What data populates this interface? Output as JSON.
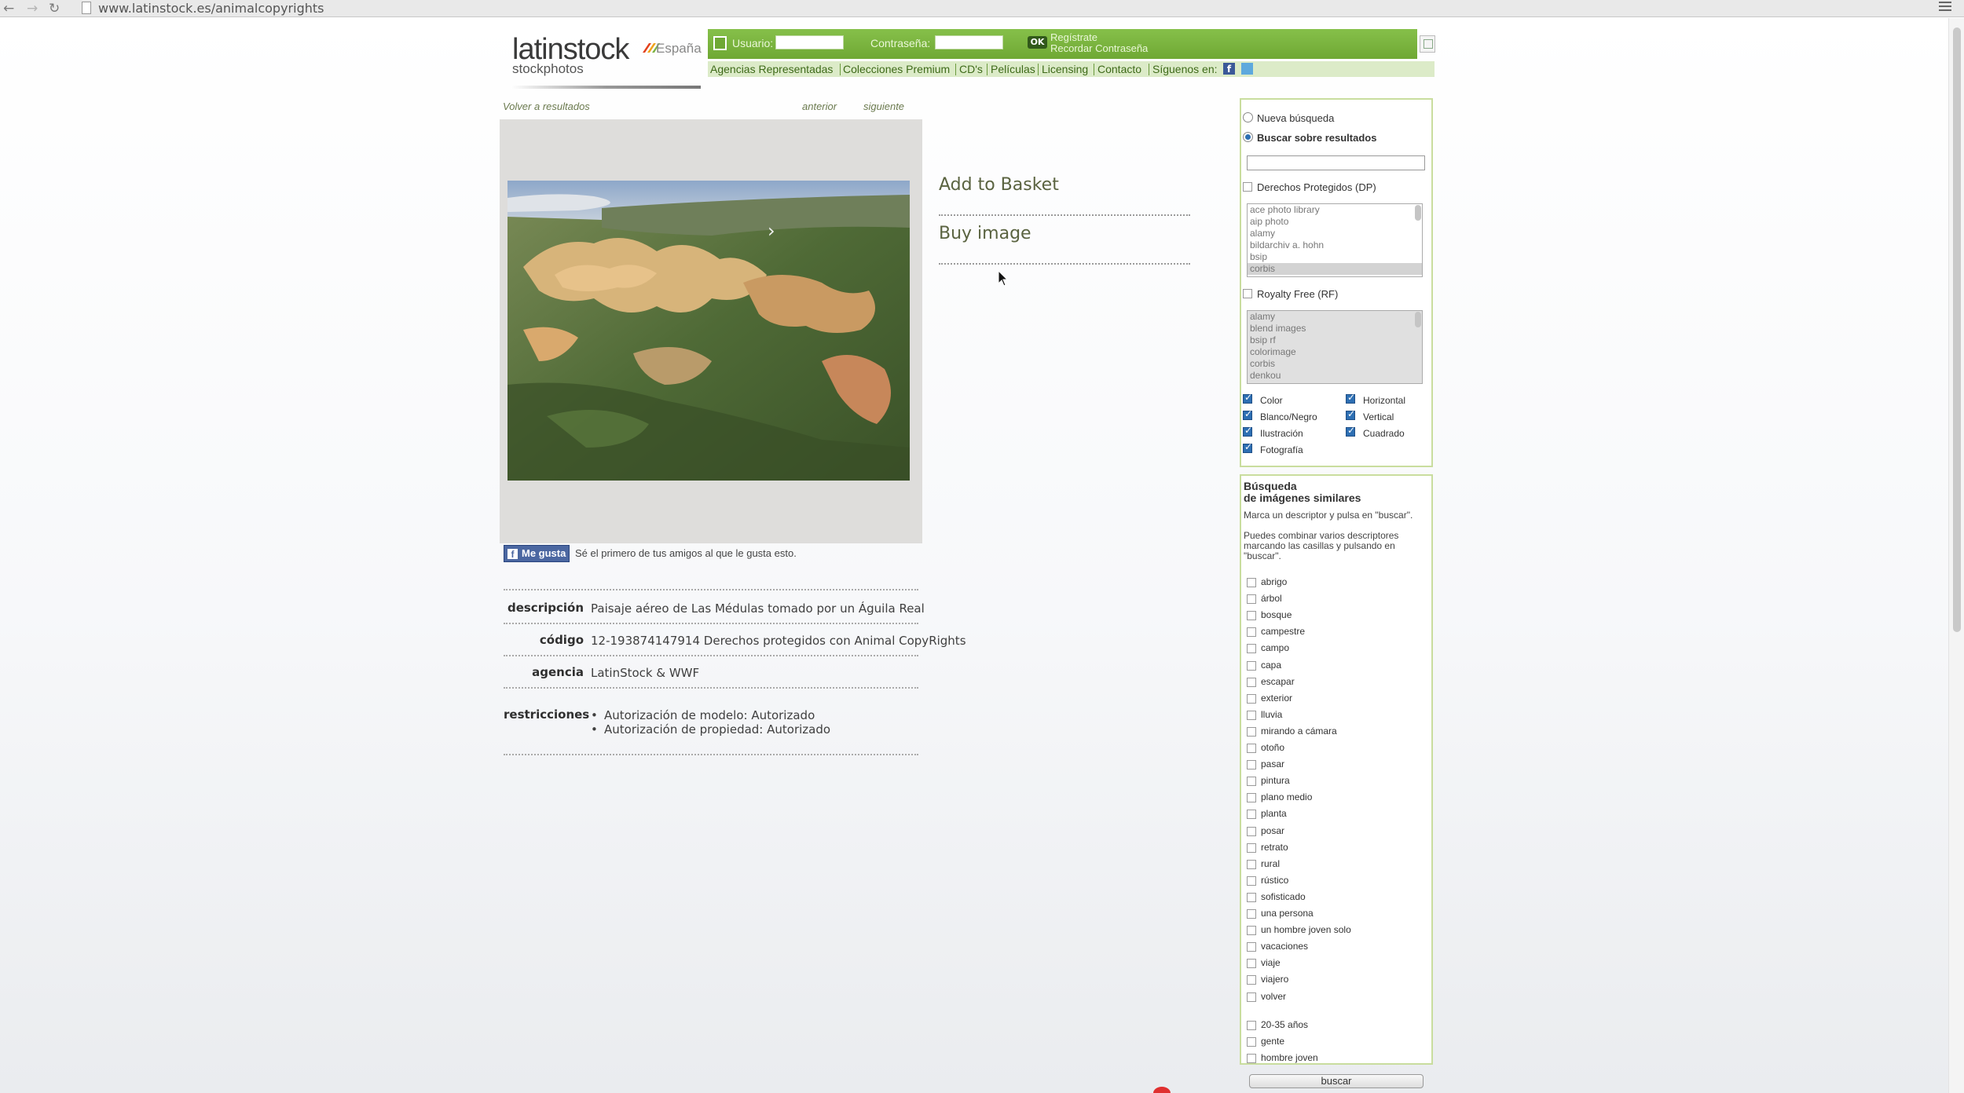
{
  "browser": {
    "url": "www.latinstock.es/animalcopyrights",
    "back_icon": "←",
    "forward_icon": "→",
    "reload_icon": "↻"
  },
  "header": {
    "logo_main": "latinstock",
    "logo_sub": "stockphotos",
    "country": "España",
    "user_label": "Usuario:",
    "password_label": "Contraseña:",
    "ok_label": "OK",
    "register_link": "Regístrate",
    "recover_link": "Recordar Contraseña",
    "nav": [
      "Agencias Representadas",
      "Colecciones Premium",
      "CD's",
      "Películas",
      "Licensing",
      "Contacto",
      "Síguenos en:"
    ],
    "accent_color": "#7cb342"
  },
  "detail": {
    "back_link": "Volver a resultados",
    "prev_link": "anterior",
    "next_link": "siguiente",
    "add_basket": "Add to Basket",
    "buy_image": "Buy image",
    "fb_like": "Me gusta",
    "fb_text": "Sé el primero de tus amigos al que le gusta esto.",
    "labels": {
      "descripcion": "descripción",
      "codigo": "código",
      "agencia": "agencia",
      "restricciones": "restricciones"
    },
    "values": {
      "descripcion": "Paisaje aéreo de Las Médulas tomado por un Águila Real",
      "codigo": "12-193874147914 Derechos protegidos con Animal CopyRights",
      "agencia": "LatinStock & WWF"
    },
    "restricciones": [
      "Autorización de modelo: Autorizado",
      "Autorización de propiedad: Autorizado"
    ]
  },
  "sidebar": {
    "new_search": "Nueva búsqueda",
    "search_results": "Buscar sobre resultados",
    "dp_label": "Derechos Protegidos (DP)",
    "dp_list": [
      "ace photo library",
      "aip photo",
      "alamy",
      "bildarchiv a. hohn",
      "bsip",
      "corbis"
    ],
    "rf_label": "Royalty Free (RF)",
    "rf_list": [
      "alamy",
      "blend images",
      "bsip rf",
      "colorimage",
      "corbis",
      "denkou"
    ],
    "filters_left": [
      "Color",
      "Blanco/Negro",
      "Ilustración",
      "Fotografía"
    ],
    "filters_right": [
      "Horizontal",
      "Vertical",
      "Cuadrado"
    ],
    "similar_title_1": "Búsqueda",
    "similar_title_2": "de imágenes similares",
    "similar_hint_1": "Marca un descriptor y pulsa en \"buscar\".",
    "similar_hint_2": "Puedes combinar varios descriptores marcando las casillas y pulsando en \"buscar\".",
    "descriptors": [
      "abrigo",
      "árbol",
      "bosque",
      "campestre",
      "campo",
      "capa",
      "escapar",
      "exterior",
      "lluvia",
      "mirando a cámara",
      "otoño",
      "pasar",
      "pintura",
      "plano medio",
      "planta",
      "posar",
      "retrato",
      "rural",
      "rústico",
      "sofisticado",
      "una persona",
      "un hombre joven solo",
      "vacaciones",
      "viaje",
      "viajero",
      "volver"
    ],
    "descriptors_2": [
      "20-35 años",
      "gente",
      "hombre joven"
    ],
    "buscar": "buscar"
  }
}
